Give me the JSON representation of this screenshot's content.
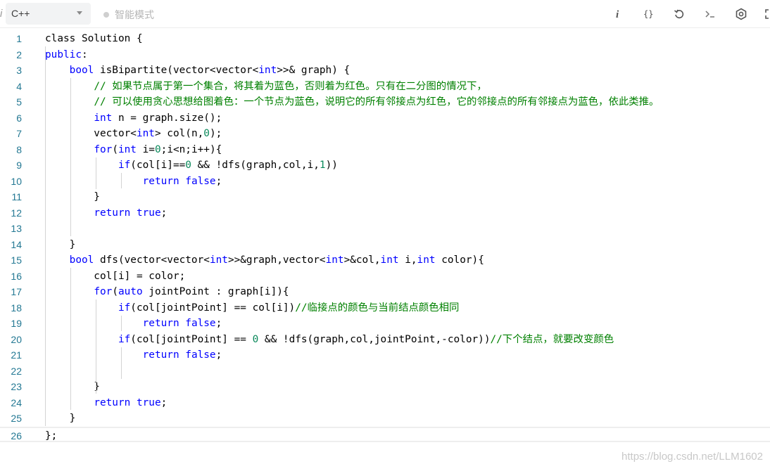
{
  "toolbar": {
    "info_glyph": "i",
    "language": "C++",
    "smart_mode_label": "智能模式",
    "tools": [
      "info-icon",
      "braces-icon",
      "reset-icon",
      "terminal-icon",
      "settings-icon",
      "fullscreen-icon"
    ]
  },
  "editor": {
    "lines": [
      [
        {
          "t": "class Solution {"
        }
      ],
      [
        {
          "t": "public",
          "c": "kw"
        },
        {
          "t": ":"
        }
      ],
      [
        {
          "t": "    "
        },
        {
          "t": "bool",
          "c": "kw"
        },
        {
          "t": " isBipartite(vector<vector<"
        },
        {
          "t": "int",
          "c": "kw"
        },
        {
          "t": ">>& graph) {"
        }
      ],
      [
        {
          "t": "        "
        },
        {
          "t": "// 如果节点属于第一个集合，将其着为蓝色，否则着为红色。只有在二分图的情况下，",
          "c": "cm"
        }
      ],
      [
        {
          "t": "        "
        },
        {
          "t": "// 可以使用贪心思想给图着色：一个节点为蓝色，说明它的所有邻接点为红色，它的邻接点的所有邻接点为蓝色，依此类推。",
          "c": "cm"
        }
      ],
      [
        {
          "t": "        "
        },
        {
          "t": "int",
          "c": "kw"
        },
        {
          "t": " n = graph.size();"
        }
      ],
      [
        {
          "t": "        vector<"
        },
        {
          "t": "int",
          "c": "kw"
        },
        {
          "t": "> col(n,"
        },
        {
          "t": "0",
          "c": "nm"
        },
        {
          "t": ");"
        }
      ],
      [
        {
          "t": "        "
        },
        {
          "t": "for",
          "c": "kw"
        },
        {
          "t": "("
        },
        {
          "t": "int",
          "c": "kw"
        },
        {
          "t": " i="
        },
        {
          "t": "0",
          "c": "nm"
        },
        {
          "t": ";i<n;i++){"
        }
      ],
      [
        {
          "t": "            "
        },
        {
          "t": "if",
          "c": "kw"
        },
        {
          "t": "(col[i]=="
        },
        {
          "t": "0",
          "c": "nm"
        },
        {
          "t": " && !dfs(graph,col,i,"
        },
        {
          "t": "1",
          "c": "nm"
        },
        {
          "t": "))"
        }
      ],
      [
        {
          "t": "                "
        },
        {
          "t": "return",
          "c": "kw"
        },
        {
          "t": " "
        },
        {
          "t": "false",
          "c": "kw"
        },
        {
          "t": ";"
        }
      ],
      [
        {
          "t": "        }"
        }
      ],
      [
        {
          "t": "        "
        },
        {
          "t": "return",
          "c": "kw"
        },
        {
          "t": " "
        },
        {
          "t": "true",
          "c": "kw"
        },
        {
          "t": ";"
        }
      ],
      [
        {
          "t": ""
        }
      ],
      [
        {
          "t": "    }"
        }
      ],
      [
        {
          "t": "    "
        },
        {
          "t": "bool",
          "c": "kw"
        },
        {
          "t": " dfs(vector<vector<"
        },
        {
          "t": "int",
          "c": "kw"
        },
        {
          "t": ">>&graph,vector<"
        },
        {
          "t": "int",
          "c": "kw"
        },
        {
          "t": ">&col,"
        },
        {
          "t": "int",
          "c": "kw"
        },
        {
          "t": " i,"
        },
        {
          "t": "int",
          "c": "kw"
        },
        {
          "t": " color){"
        }
      ],
      [
        {
          "t": "        col[i] = color;"
        }
      ],
      [
        {
          "t": "        "
        },
        {
          "t": "for",
          "c": "kw"
        },
        {
          "t": "("
        },
        {
          "t": "auto",
          "c": "kw"
        },
        {
          "t": " jointPoint : graph[i]){"
        }
      ],
      [
        {
          "t": "            "
        },
        {
          "t": "if",
          "c": "kw"
        },
        {
          "t": "(col[jointPoint] == col[i])"
        },
        {
          "t": "//临接点的颜色与当前结点颜色相同",
          "c": "cm"
        }
      ],
      [
        {
          "t": "                "
        },
        {
          "t": "return",
          "c": "kw"
        },
        {
          "t": " "
        },
        {
          "t": "false",
          "c": "kw"
        },
        {
          "t": ";"
        }
      ],
      [
        {
          "t": "            "
        },
        {
          "t": "if",
          "c": "kw"
        },
        {
          "t": "(col[jointPoint] == "
        },
        {
          "t": "0",
          "c": "nm"
        },
        {
          "t": " && !dfs(graph,col,jointPoint,-color))"
        },
        {
          "t": "//下个结点，就要改变颜色",
          "c": "cm"
        }
      ],
      [
        {
          "t": "                "
        },
        {
          "t": "return",
          "c": "kw"
        },
        {
          "t": " "
        },
        {
          "t": "false",
          "c": "kw"
        },
        {
          "t": ";"
        }
      ],
      [
        {
          "t": ""
        }
      ],
      [
        {
          "t": "        }"
        }
      ],
      [
        {
          "t": "        "
        },
        {
          "t": "return",
          "c": "kw"
        },
        {
          "t": " "
        },
        {
          "t": "true",
          "c": "kw"
        },
        {
          "t": ";"
        }
      ],
      [
        {
          "t": "    }"
        }
      ],
      [
        {
          "t": "};"
        }
      ]
    ],
    "active_line": 26
  },
  "watermark": "https://blog.csdn.net/LLM1602",
  "colors": {
    "keyword": "#0000ff",
    "comment": "#008000",
    "number": "#09885a",
    "line_number": "#237893"
  }
}
